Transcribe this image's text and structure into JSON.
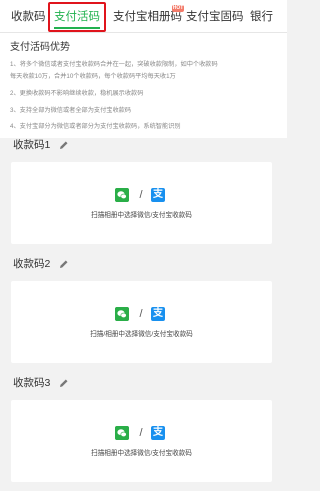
{
  "tabs": [
    {
      "label": "收款码",
      "active": false
    },
    {
      "label": "支付活码",
      "active": true
    },
    {
      "label": "支付宝相册码",
      "active": false,
      "badge": "HOT"
    },
    {
      "label": "支付宝固码",
      "active": false
    },
    {
      "label": "银行",
      "active": false
    }
  ],
  "advantages": {
    "title": "支付活码优势",
    "lines": [
      "1、将多个微信或者支付宝收款码合并在一起，突破收款限制，如中个收款码",
      "每天收款10万，合并10个收款码，每个收款码平均每天收1万",
      "2、更换收款码不影响继续收款，稳机展示收款码",
      "3、支持全部为微信或者全部为支付宝收款码",
      "4、支付宝部分为微信或者部分为支付宝收款码，系统智能识别"
    ]
  },
  "codes": [
    {
      "title": "收款码1",
      "caption": "扫描相册中选择微信/支付宝收款码"
    },
    {
      "title": "收款码2",
      "caption": "扫描/相册中选择微信/支付宝收款码"
    },
    {
      "title": "收款码3",
      "caption": "扫描相册中选择微信/支付宝收款码"
    }
  ],
  "icons": {
    "wechat": "wechat-icon",
    "alipay": "alipay-icon",
    "alipay_glyph": "支",
    "separator": "/",
    "edit": "pencil-icon"
  },
  "colors": {
    "accent": "#21b14f",
    "highlight": "#e0141c",
    "wechat": "#2aae48",
    "alipay": "#1890ef"
  }
}
